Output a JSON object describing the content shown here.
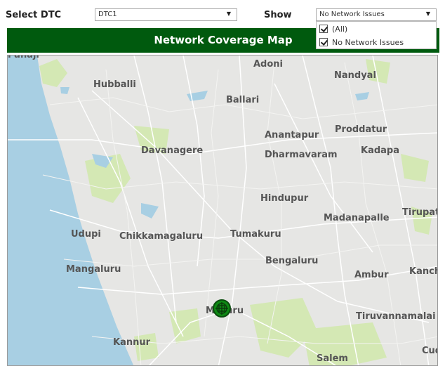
{
  "controls": {
    "select_dtc_label": "Select DTC",
    "select_dtc_value": "DTC1",
    "show_label": "Show",
    "show_value": "No Network Issues"
  },
  "dropdown": {
    "options": [
      {
        "label": "(All)",
        "checked": true
      },
      {
        "label": "No Network Issues",
        "checked": true
      }
    ]
  },
  "banner": {
    "title": "Network Coverage Map"
  },
  "map": {
    "cities": [
      "Panaji",
      "Hubballi",
      "Adoni",
      "Nandyal",
      "Ballari",
      "Anantapur",
      "Proddatur",
      "Davanagere",
      "Dharmavaram",
      "Kadapa",
      "Hindupur",
      "Udupi",
      "Chikkamagaluru",
      "Tumakuru",
      "Madanapalle",
      "Tirupat",
      "Mangaluru",
      "Bengaluru",
      "Ambur",
      "Kanch",
      "Mysuru",
      "Tiruvannamalai",
      "Kannur",
      "Salem",
      "Cud"
    ],
    "marker_icon": "network-tower-marker-icon"
  },
  "colors": {
    "banner": "#005a0e",
    "marker": "#0e8a14",
    "sea": "#a8cfe3",
    "land": "#e6e6e4",
    "park": "#d4e8b4"
  }
}
